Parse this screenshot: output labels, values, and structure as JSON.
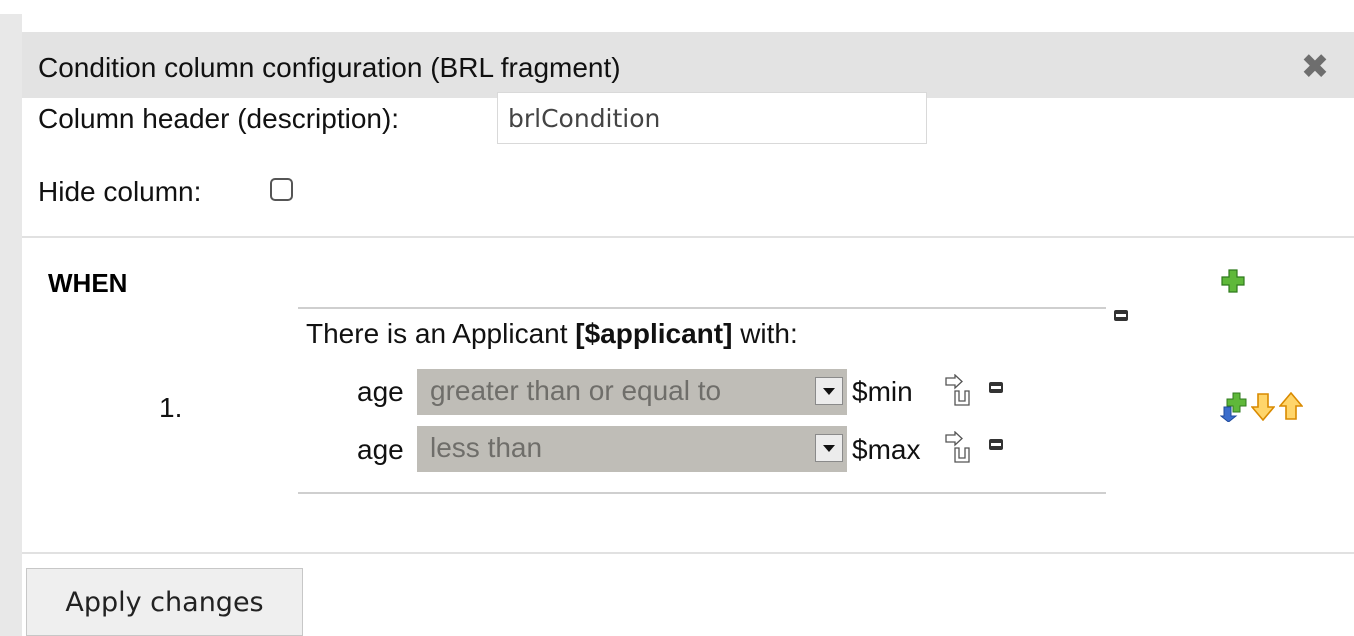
{
  "dialog": {
    "title": "Condition column configuration (BRL fragment)",
    "close_icon": "close-icon"
  },
  "form": {
    "header_label": "Column header (description):",
    "header_value": "brlCondition",
    "hide_label": "Hide column:",
    "hide_checked": false
  },
  "rule": {
    "when_label": "WHEN",
    "row_number": "1.",
    "pattern": {
      "prefix": "There is an Applicant",
      "binding": "[$applicant]",
      "suffix": "with:"
    },
    "constraints": [
      {
        "field": "age",
        "operator": "greater than or equal to",
        "variable": "$min"
      },
      {
        "field": "age",
        "operator": "less than",
        "variable": "$max"
      }
    ]
  },
  "actions": {
    "apply_label": "Apply changes"
  },
  "colors": {
    "titlebar_bg": "#e3e3e3",
    "select_bg": "#bfbdb7",
    "plus_green": "#5fb83a",
    "arrow_orange": "#f2a21b",
    "plus_blue": "#3b6dcc"
  }
}
